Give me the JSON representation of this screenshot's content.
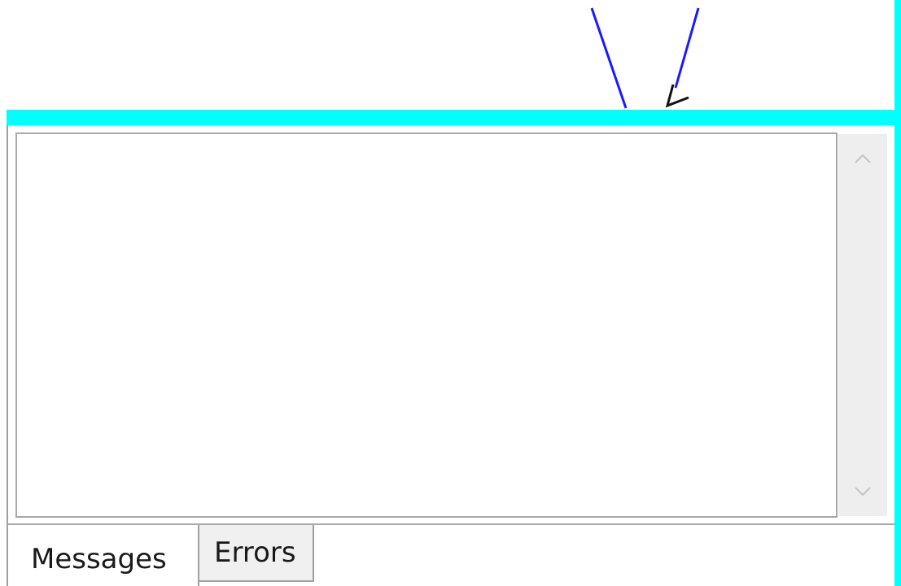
{
  "canvas": {
    "line_color": "#1a1aff",
    "cursor_glyph": "↙"
  },
  "message_panel": {
    "text_content": "",
    "scrollbar": {
      "up_icon": "chevron-up-icon",
      "down_icon": "chevron-down-icon"
    }
  },
  "tabs": [
    {
      "label": "Messages",
      "selected": true
    },
    {
      "label": "Errors",
      "selected": false
    }
  ],
  "colors": {
    "splitter": "#00ffff",
    "border": "#00ffff",
    "inactive_tab_bg": "#f0f0f0",
    "scrollbar_track": "#eeeeee"
  }
}
